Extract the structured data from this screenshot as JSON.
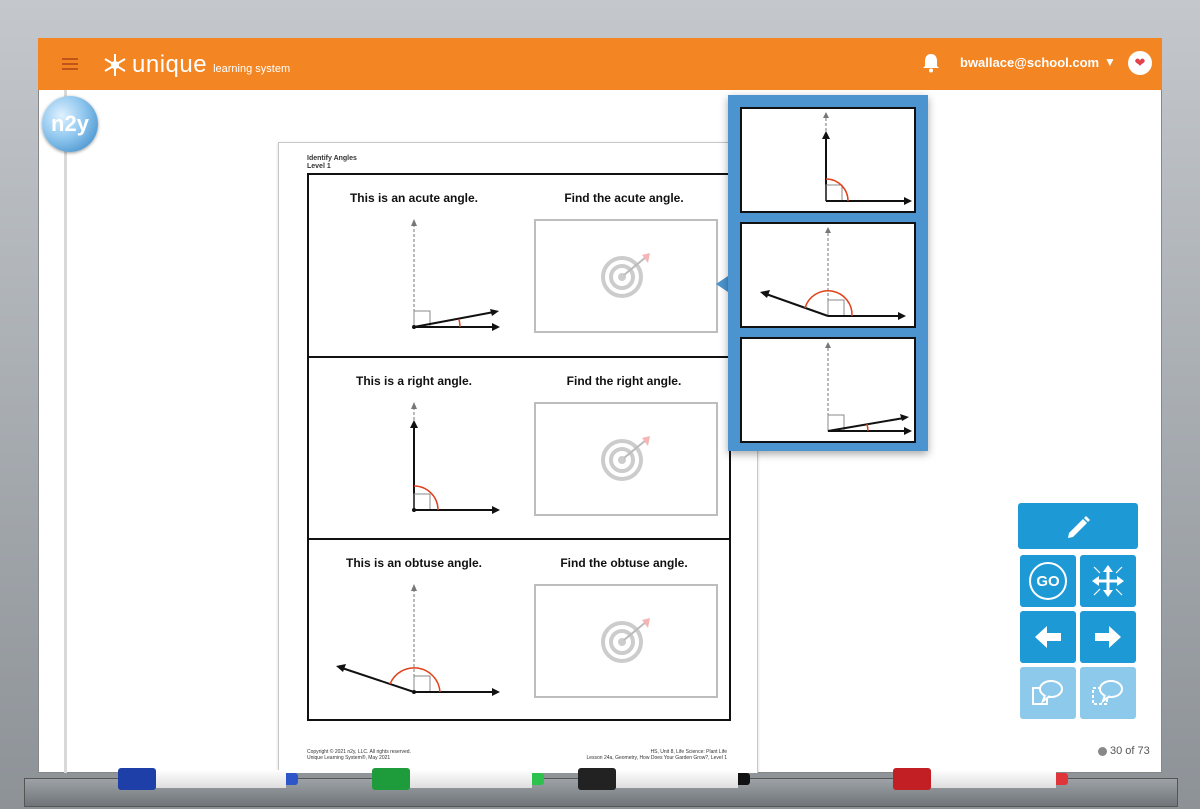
{
  "header": {
    "brand": "unique",
    "brand_sub": "learning system",
    "user_email": "bwallace@school.com"
  },
  "badge": {
    "n2y": "n2y"
  },
  "worksheet": {
    "title_line1": "Identify Angles",
    "title_line2": "Level 1",
    "rows": [
      {
        "left_label": "This is an acute angle.",
        "right_label": "Find the acute angle."
      },
      {
        "left_label": "This is a right angle.",
        "right_label": "Find the right angle."
      },
      {
        "left_label": "This is an obtuse angle.",
        "right_label": "Find the obtuse angle."
      }
    ],
    "footer_left_1": "Copyright © 2021 n2y, LLC. All rights reserved.",
    "footer_left_2": "Unique Learning System®, May 2021",
    "footer_right_1": "HS, Unit 8, Life Science: Plant Life",
    "footer_right_2": "Lesson 24a, Geometry, How Does Your Garden Grow?, Level 1"
  },
  "choices_popup": {
    "items": [
      "right-angle",
      "obtuse-angle",
      "acute-angle"
    ]
  },
  "tools": {
    "go_label": "GO"
  },
  "pager": {
    "text": "30 of 73"
  },
  "colors": {
    "appbar": "#f38523",
    "popup": "#4b94cf",
    "tool_button": "#1d9ad6",
    "angle_arc": "#e0401a"
  },
  "markers": [
    "blue",
    "green",
    "black",
    "red"
  ]
}
